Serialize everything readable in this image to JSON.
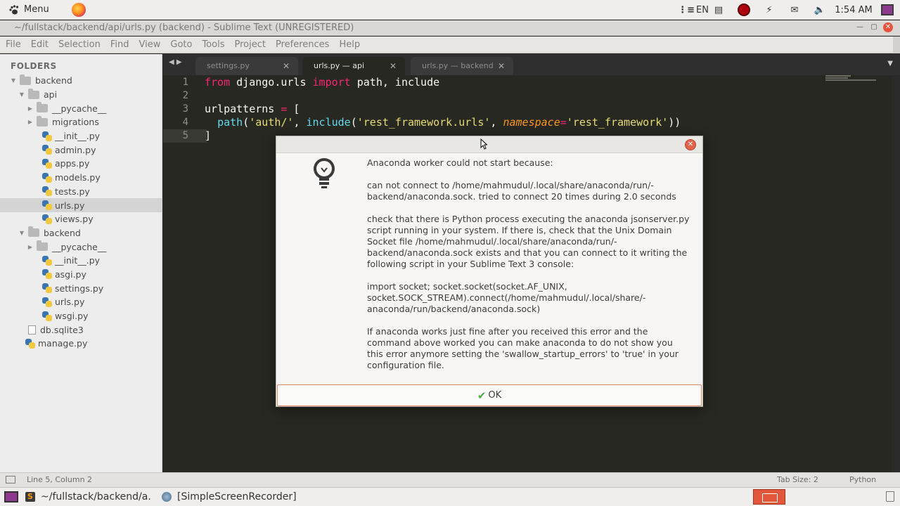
{
  "system_panel": {
    "menu_label": "Menu",
    "keyboard_layout": "EN",
    "clock": "1:54 AM"
  },
  "window": {
    "title": "~/fullstack/backend/api/urls.py (backend) - Sublime Text (UNREGISTERED)"
  },
  "menubar": {
    "items": [
      "File",
      "Edit",
      "Selection",
      "Find",
      "View",
      "Goto",
      "Tools",
      "Project",
      "Preferences",
      "Help"
    ]
  },
  "sidebar": {
    "heading": "FOLDERS",
    "tree": [
      {
        "label": "backend",
        "kind": "folder",
        "depth": 0,
        "expanded": true
      },
      {
        "label": "api",
        "kind": "folder",
        "depth": 1,
        "expanded": true
      },
      {
        "label": "__pycache__",
        "kind": "folder",
        "depth": 2,
        "expanded": false
      },
      {
        "label": "migrations",
        "kind": "folder",
        "depth": 2,
        "expanded": false
      },
      {
        "label": "__init__.py",
        "kind": "py",
        "depth": 2
      },
      {
        "label": "admin.py",
        "kind": "py",
        "depth": 2
      },
      {
        "label": "apps.py",
        "kind": "py",
        "depth": 2
      },
      {
        "label": "models.py",
        "kind": "py",
        "depth": 2
      },
      {
        "label": "tests.py",
        "kind": "py",
        "depth": 2
      },
      {
        "label": "urls.py",
        "kind": "py",
        "depth": 2,
        "selected": true
      },
      {
        "label": "views.py",
        "kind": "py",
        "depth": 2
      },
      {
        "label": "backend",
        "kind": "folder",
        "depth": 1,
        "expanded": true
      },
      {
        "label": "__pycache__",
        "kind": "folder",
        "depth": 2,
        "expanded": false
      },
      {
        "label": "__init__.py",
        "kind": "py",
        "depth": 2
      },
      {
        "label": "asgi.py",
        "kind": "py",
        "depth": 2
      },
      {
        "label": "settings.py",
        "kind": "py",
        "depth": 2
      },
      {
        "label": "urls.py",
        "kind": "py",
        "depth": 2
      },
      {
        "label": "wsgi.py",
        "kind": "py",
        "depth": 2
      },
      {
        "label": "db.sqlite3",
        "kind": "file",
        "depth": 1
      },
      {
        "label": "manage.py",
        "kind": "py",
        "depth": 1
      }
    ]
  },
  "tabs": [
    {
      "label": "settings.py",
      "active": false
    },
    {
      "label": "urls.py — api",
      "active": true
    },
    {
      "label": "urls.py — backend",
      "active": false
    }
  ],
  "editor": {
    "line_numbers": [
      "1",
      "2",
      "3",
      "4",
      "5"
    ],
    "lines": [
      [
        {
          "t": "from",
          "c": "kw"
        },
        {
          "t": " django.urls ",
          "c": ""
        },
        {
          "t": "import",
          "c": "kw"
        },
        {
          "t": " path, include",
          "c": ""
        }
      ],
      [],
      [
        {
          "t": "urlpatterns ",
          "c": ""
        },
        {
          "t": "=",
          "c": "kw"
        },
        {
          "t": " [",
          "c": ""
        }
      ],
      [
        {
          "t": "  ",
          "c": ""
        },
        {
          "t": "path",
          "c": "fn"
        },
        {
          "t": "(",
          "c": ""
        },
        {
          "t": "'auth/'",
          "c": "str"
        },
        {
          "t": ", ",
          "c": ""
        },
        {
          "t": "include",
          "c": "fn"
        },
        {
          "t": "(",
          "c": ""
        },
        {
          "t": "'rest_framework.urls'",
          "c": "str"
        },
        {
          "t": ", ",
          "c": ""
        },
        {
          "t": "namespace",
          "c": "arg"
        },
        {
          "t": "=",
          "c": "kw"
        },
        {
          "t": "'rest_framework'",
          "c": "str"
        },
        {
          "t": "))",
          "c": ""
        }
      ],
      [
        {
          "t": "]",
          "c": ""
        }
      ]
    ],
    "current_line": 5
  },
  "dialog": {
    "paragraphs": [
      "Anaconda worker could not start because:",
      "can not connect to /home/mahmudul/.local/share/anaconda/run/-backend/anaconda.sock. tried to connect 20 times during 2.0 seconds",
      "check that there is Python process executing the anaconda jsonserver.py script running in your system. If there is, check that the Unix Domain Socket file /home/mahmudul/.local/share/anaconda/run/-backend/anaconda.sock exists and that you can connect to it writing the following script in your Sublime Text 3 console:",
      "import socket; socket.socket(socket.AF_UNIX, socket.SOCK_STREAM).connect(/home/mahmudul/.local/share/-anaconda/run/backend/anaconda.sock)",
      "If anaconda works just fine after you received this error and the command above worked you can make anaconda to do not show you this error anymore setting the 'swallow_startup_errors' to 'true' in your configuration file."
    ],
    "ok_label": "OK"
  },
  "statusbar": {
    "position": "Line 5, Column 2",
    "tab_size": "Tab Size: 2",
    "syntax": "Python"
  },
  "taskbar": {
    "task1": "~/fullstack/backend/a...",
    "task2": "[SimpleScreenRecorder]"
  },
  "colors": {
    "editor_bg": "#272822",
    "keyword": "#f92672",
    "string": "#e6db74",
    "function": "#66d9ef",
    "argument": "#fd971f",
    "ok_border": "#e0826d",
    "check": "#4bab3e"
  }
}
